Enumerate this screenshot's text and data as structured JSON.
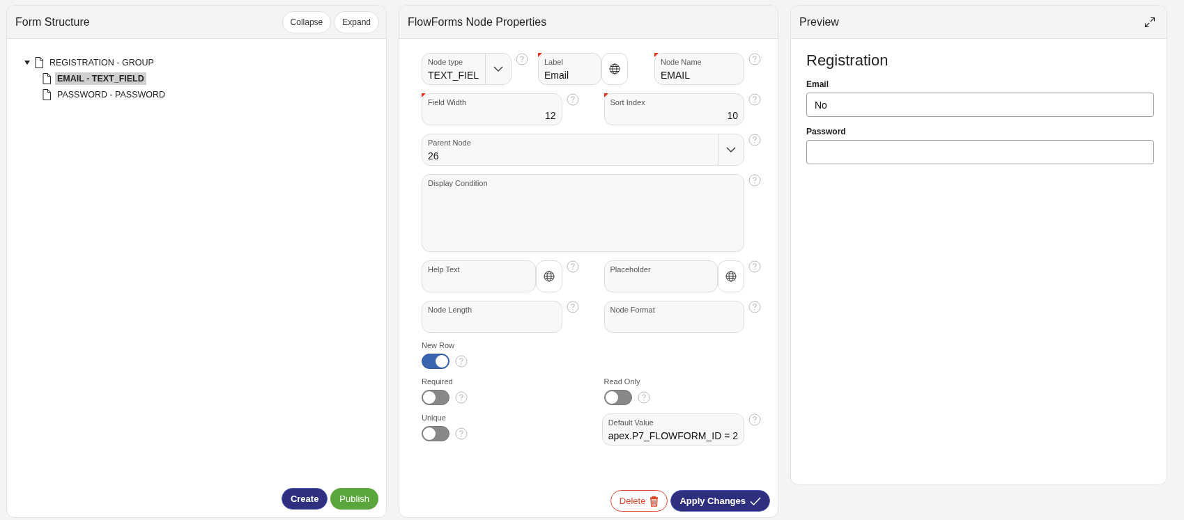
{
  "form_structure": {
    "title": "Form Structure",
    "buttons": [
      "Collapse",
      "Expand"
    ],
    "tree": [
      {
        "label": "REGISTRATION - GROUP",
        "expanded": true,
        "selected": false,
        "children": [
          {
            "label": "EMAIL - TEXT_FIELD",
            "selected": true
          },
          {
            "label": "PASSWORD - PASSWORD",
            "selected": false
          }
        ]
      }
    ],
    "footer_buttons": [
      {
        "label": "Create",
        "kind": "primary"
      },
      {
        "label": "Publish",
        "kind": "success"
      }
    ]
  },
  "properties": {
    "title": "FlowForms Node Properties",
    "rows": [
      [
        {
          "kind": "select",
          "label": "Node type",
          "value": "TEXT_FIEL",
          "required": false,
          "help": true
        },
        {
          "kind": "translatable",
          "label": "Label",
          "value": "Email",
          "required": true,
          "help": false
        },
        {
          "kind": "text",
          "label": "Node Name",
          "value": "EMAIL",
          "required": true,
          "help": true
        }
      ],
      [
        {
          "kind": "number",
          "label": "Field Width",
          "value": "12",
          "required": true,
          "help": true
        },
        {
          "kind": "number",
          "label": "Sort Index",
          "value": "10",
          "required": true,
          "help": true
        }
      ],
      [
        {
          "kind": "select",
          "label": "Parent Node",
          "value": "26",
          "required": false,
          "help": true
        }
      ],
      [
        {
          "kind": "textarea",
          "label": "Display Condition",
          "required": false,
          "help": true
        }
      ],
      [
        {
          "kind": "translatable",
          "label": "Help Text",
          "required": false,
          "help": true
        },
        {
          "kind": "translatable",
          "label": "Placeholder",
          "required": false,
          "help": true
        }
      ],
      [
        {
          "kind": "text",
          "label": "Node Length",
          "required": false,
          "help": true
        },
        {
          "kind": "text",
          "label": "Node Format",
          "required": false,
          "help": true
        }
      ],
      [
        {
          "kind": "toggle",
          "label": "New Row",
          "on": true,
          "help": true
        },
        {
          "kind": "empty"
        }
      ],
      [
        {
          "kind": "toggle",
          "label": "Required",
          "on": false,
          "help": true
        },
        {
          "kind": "toggle",
          "label": "Read Only",
          "on": false,
          "help": true
        }
      ],
      [
        {
          "kind": "toggle",
          "label": "Unique",
          "on": false,
          "help": true
        },
        {
          "kind": "text",
          "label": "Default Value",
          "value": "apex.P7_FLOWFORM_ID = 2",
          "required": false,
          "help": true
        }
      ]
    ],
    "footer_buttons": [
      {
        "label": "Delete",
        "kind": "danger"
      },
      {
        "label": "Apply Changes",
        "kind": "primary"
      }
    ]
  },
  "preview": {
    "title": "Preview",
    "heading": "Registration",
    "fields": [
      {
        "label": "Email",
        "value": "No"
      },
      {
        "label": "Password"
      }
    ]
  }
}
